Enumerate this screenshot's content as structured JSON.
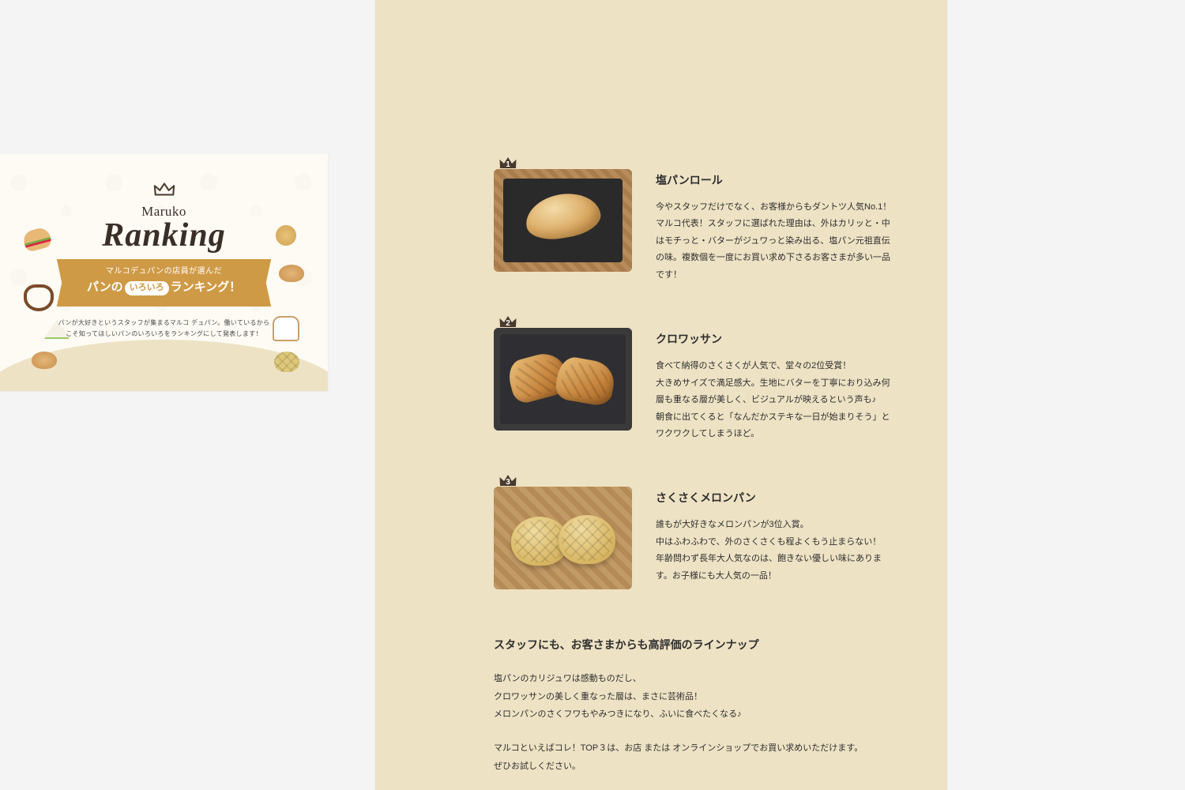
{
  "hero": {
    "brand": "Maruko",
    "title": "Ranking",
    "ribbon_line1": "マルコデュパンの店員が選んだ",
    "ribbon_prefix": "パンの",
    "ribbon_pill": "いろいろ",
    "ribbon_suffix": "ランキング！",
    "description_l1": "パンが大好きというスタッフが集まるマルコ デュパン。働いているから",
    "description_l2": "こそ知ってほしいパンのいろいろをランキングにして発表します！"
  },
  "colors": {
    "panel_bg": "#ede2c4",
    "ribbon": "#cf9a45",
    "text": "#2e2e2e",
    "crown": "#4a3a2e"
  },
  "ranking": [
    {
      "rank": "1",
      "name": "塩パンロール",
      "desc": "今やスタッフだけでなく、お客様からもダントツ人気No.1！マルコ代表！スタッフに選ばれた理由は、外はカリッと・中はモチっと・バターがジュワっと染み出る、塩パン元祖直伝の味。複数個を一度にお買い求め下さるお客さまが多い一品です！"
    },
    {
      "rank": "2",
      "name": "クロワッサン",
      "desc": "食べて納得のさくさくが人気で、堂々の2位受賞！\n大きめサイズで満足感大。生地にバターを丁寧におり込み何層も重なる層が美しく、ビジュアルが映えるという声も♪\n朝食に出てくると「なんだかステキな一日が始まりそう」とワクワクしてしまうほど。"
    },
    {
      "rank": "3",
      "name": "さくさくメロンパン",
      "desc": "誰もが大好きなメロンパンが3位入賞。\n中はふわふわで、外のさくさくも程よくもう止まらない！\n年齢問わず長年大人気なのは、飽きない優しい味にあります。お子様にも大人気の一品！"
    }
  ],
  "summary": {
    "heading": "スタッフにも、お客さまからも高評価のラインナップ",
    "para1": "塩パンのカリジュワは感動ものだし、\nクロワッサンの美しく重なった層は、まさに芸術品！\nメロンパンのさくフワもやみつきになり、ふいに食べたくなる♪",
    "para2": "マルコといえばコレ！TOP３は、お店 または オンラインショップでお買い求めいただけます。\nぜひお試しください。"
  }
}
